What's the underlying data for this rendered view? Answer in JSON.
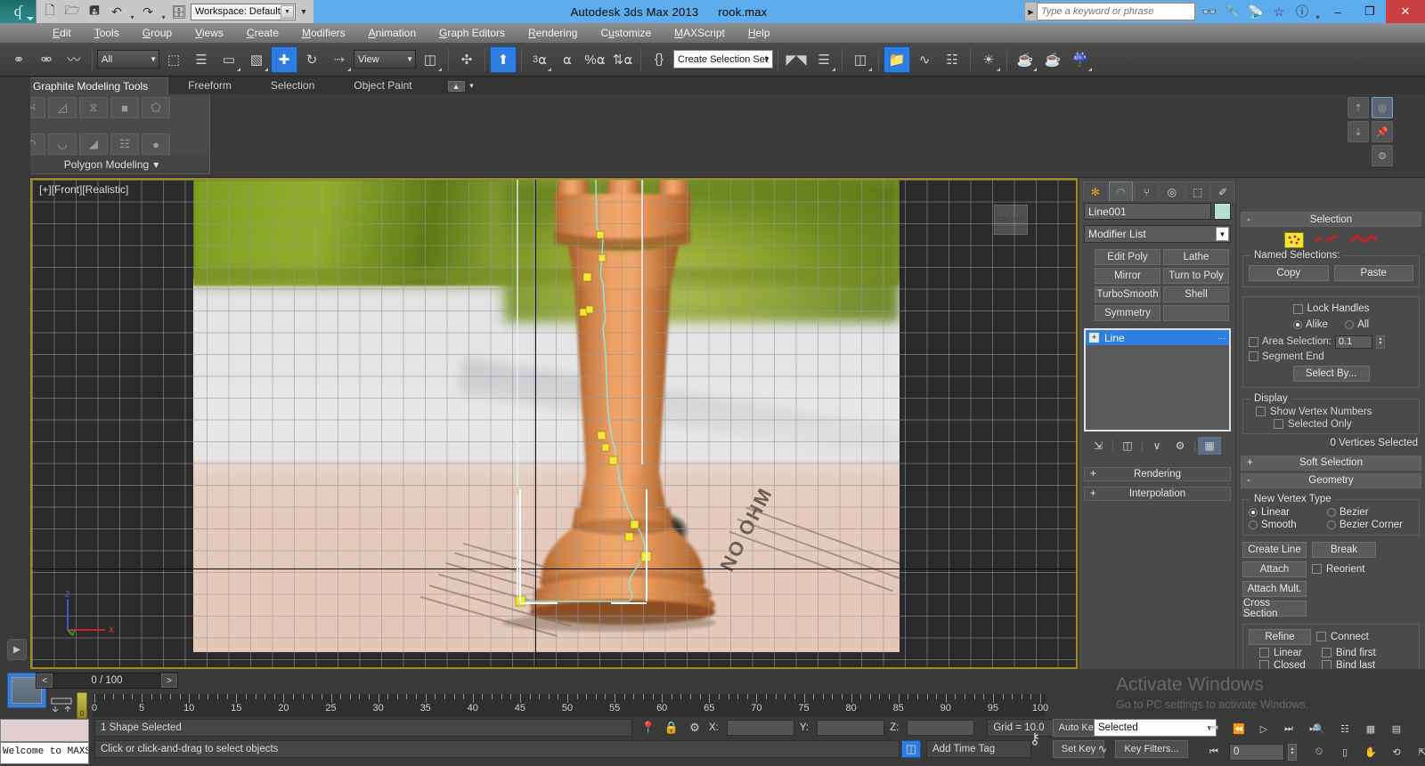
{
  "app": {
    "title": "Autodesk 3ds Max  2013",
    "filename": "rook.max",
    "logo_glyph": "ʘ"
  },
  "quick_access": {
    "workspace_label": "Workspace: Default",
    "buttons": [
      {
        "name": "new-file",
        "glyph": "❐"
      },
      {
        "name": "open-file",
        "glyph": "☐"
      },
      {
        "name": "save-file",
        "glyph": "⬓"
      },
      {
        "name": "undo",
        "glyph": "↶"
      },
      {
        "name": "redo",
        "glyph": "↷"
      },
      {
        "name": "project-folder",
        "glyph": "⧉"
      }
    ]
  },
  "search": {
    "placeholder": "Type a keyword or phrase",
    "icons": [
      "binoculars-icon",
      "wrench-icon",
      "satellite-icon",
      "star-icon",
      "help-icon"
    ]
  },
  "window_controls": {
    "minimize": "–",
    "restore": "❐",
    "close": "✕"
  },
  "menubar": {
    "items": [
      {
        "label": "Edit",
        "accel": "E"
      },
      {
        "label": "Tools",
        "accel": "T"
      },
      {
        "label": "Group",
        "accel": "G"
      },
      {
        "label": "Views",
        "accel": "V"
      },
      {
        "label": "Create",
        "accel": "C"
      },
      {
        "label": "Modifiers",
        "accel": "M"
      },
      {
        "label": "Animation",
        "accel": "A"
      },
      {
        "label": "Graph Editors",
        "accel": "G"
      },
      {
        "label": "Rendering",
        "accel": "R"
      },
      {
        "label": "Customize",
        "accel": "u"
      },
      {
        "label": "MAXScript",
        "accel": "M"
      },
      {
        "label": "Help",
        "accel": "H"
      }
    ]
  },
  "main_toolbar": {
    "selection_filter": "All",
    "reference_coord": "View",
    "named_selection_set": "Create Selection Set",
    "snap_percent": "%",
    "snap_number": "3",
    "buttons": [
      {
        "name": "select-and-link",
        "glyph": "⚭"
      },
      {
        "name": "unlink-selection",
        "glyph": "⚮"
      },
      {
        "name": "bind-to-space-warp",
        "glyph": "〰"
      },
      {
        "name": "select-object",
        "glyph": "⬚"
      },
      {
        "name": "select-by-name",
        "glyph": "☰"
      },
      {
        "name": "rectangular-selection-region",
        "glyph": "▭"
      },
      {
        "name": "window-crossing",
        "glyph": "▧"
      },
      {
        "name": "select-and-move",
        "glyph": "✚"
      },
      {
        "name": "select-and-rotate",
        "glyph": "↻"
      },
      {
        "name": "select-and-scale",
        "glyph": "⤡"
      },
      {
        "name": "use-center-flyout",
        "glyph": "⧉"
      },
      {
        "name": "mirror",
        "glyph": "⧉"
      },
      {
        "name": "align",
        "glyph": "⬚"
      },
      {
        "name": "layer-manager",
        "glyph": "≣"
      },
      {
        "name": "graphite-modeling-toggle",
        "glyph": "▤"
      },
      {
        "name": "curve-editor",
        "glyph": "∿"
      },
      {
        "name": "schematic-view",
        "glyph": "⬚"
      },
      {
        "name": "material-editor",
        "glyph": "◐"
      },
      {
        "name": "render-setup",
        "glyph": "⛅"
      },
      {
        "name": "rendered-frame-window",
        "glyph": "◔"
      },
      {
        "name": "render-production",
        "glyph": "◕"
      }
    ]
  },
  "ribbon": {
    "tabs": [
      {
        "label": "Graphite Modeling Tools",
        "active": true
      },
      {
        "label": "Freeform",
        "active": false
      },
      {
        "label": "Selection",
        "active": false
      },
      {
        "label": "Object Paint",
        "active": false
      }
    ],
    "panel_title": "Polygon Modeling",
    "row1": [
      "vertex-sublevel-icon",
      "edge-sublevel-icon",
      "border-sublevel-icon",
      "polygon-sublevel-icon",
      "element-sublevel-icon"
    ],
    "row2": [
      "generate-topology-icon",
      "symmetry-icon",
      "subdivision-icon",
      "preserve-uv-icon",
      "make-planar-icon"
    ],
    "side": [
      "collapse-stack-icon",
      "expand-stack-icon",
      "show-end-result-icon",
      "pin-stack-icon",
      "configure-icon"
    ]
  },
  "viewport": {
    "label": "[+][Front][Realistic]",
    "viewcube_face": "FRONT",
    "axis": {
      "x": "X",
      "y": "Y",
      "z": "Z"
    },
    "grid_color": "#969696",
    "border_color": "#9a8b22",
    "spline_color": "#8fe4d2",
    "vertex_color": "#f2e63a",
    "ref_image_text": "NO OHM"
  },
  "command_panel": {
    "tabs": [
      {
        "name": "create-tab",
        "glyph": "✻",
        "active": false
      },
      {
        "name": "modify-tab",
        "glyph": "◠",
        "active": true
      },
      {
        "name": "hierarchy-tab",
        "glyph": "⑂",
        "active": false
      },
      {
        "name": "motion-tab",
        "glyph": "◎",
        "active": false
      },
      {
        "name": "display-tab",
        "glyph": "⬚",
        "active": false
      },
      {
        "name": "utilities-tab",
        "glyph": "✐",
        "active": false
      }
    ],
    "object_name": "Line001",
    "modifier_list_label": "Modifier List",
    "modifier_buttons": [
      "Edit Poly",
      "Lathe",
      "Mirror",
      "Turn to Poly",
      "TurboSmooth",
      "Shell",
      "Symmetry",
      ""
    ],
    "stack_items": [
      {
        "label": "Line",
        "selected": true
      }
    ],
    "stack_tool_icons": [
      "pin-stack-icon",
      "show-end-result-icon",
      "make-unique-icon",
      "remove-modifier-icon",
      "configure-sets-icon"
    ],
    "rollouts_left": [
      {
        "label": "Rendering",
        "state": "+"
      },
      {
        "label": "Interpolation",
        "state": "+"
      }
    ],
    "selection_rollout": {
      "title": "Selection",
      "state": "-",
      "sublevels": [
        "vertex-icon",
        "segment-icon",
        "spline-icon"
      ],
      "named_selections_label": "Named Selections:",
      "copy": "Copy",
      "paste": "Paste",
      "lock_handles": "Lock Handles",
      "alike": "Alike",
      "all": "All",
      "area_selection": "Area Selection:",
      "area_value": "0.1",
      "segment_end": "Segment End",
      "select_by": "Select By...",
      "display_label": "Display",
      "show_vertex_numbers": "Show Vertex Numbers",
      "selected_only": "Selected Only",
      "status": "0 Vertices Selected"
    },
    "soft_selection_rollout": {
      "label": "Soft Selection",
      "state": "+"
    },
    "geometry_rollout": {
      "label": "Geometry",
      "state": "-",
      "new_vertex_type_label": "New Vertex Type",
      "vertex_types": [
        "Linear",
        "Bezier",
        "Smooth",
        "Bezier Corner"
      ],
      "vertex_type_selected": "Linear",
      "buttons": [
        "Create Line",
        "Break",
        "Attach",
        "Attach Mult.",
        "Cross Section",
        "Refine"
      ],
      "reorient": "Reorient",
      "connect": "Connect",
      "linear": "Linear",
      "closed": "Closed",
      "bind_first": "Bind first",
      "bind_last": "Bind last"
    }
  },
  "watermark": {
    "line1": "Activate Windows",
    "line2": "Go to PC settings to activate Windows."
  },
  "timeline": {
    "current_frame_display": "0 / 100",
    "prev_frame": "<",
    "next_frame": ">",
    "ticks": [
      0,
      5,
      10,
      15,
      20,
      25,
      30,
      35,
      40,
      45,
      50,
      55,
      60,
      65,
      70,
      75,
      80,
      85,
      90,
      95,
      100
    ],
    "slider_label": "0"
  },
  "status_bar": {
    "maxscript_listener_text": "Welcome to MAXS",
    "selection_status": "1 Shape Selected",
    "prompt": "Click or click-and-drag to select objects",
    "x_label": "X:",
    "y_label": "Y:",
    "z_label": "Z:",
    "x_value": "",
    "y_value": "",
    "z_value": "",
    "grid_text": "Grid = 10.0",
    "add_time_tag": "Add Time Tag",
    "auto_key": "Auto Key",
    "set_key": "Set Key",
    "key_mode": "Selected",
    "key_filters": "Key Filters...",
    "frame_value": "0",
    "nav_icons": [
      "zoom-icon",
      "zoom-all-icon",
      "zoom-extents-icon",
      "zoom-region-icon",
      "field-of-view-icon",
      "pan-icon",
      "orbit-icon",
      "maximize-viewport-icon"
    ],
    "playback_icons": [
      "go-to-start-icon",
      "previous-frame-icon",
      "play-animation-icon",
      "next-frame-icon",
      "go-to-end-icon"
    ]
  }
}
